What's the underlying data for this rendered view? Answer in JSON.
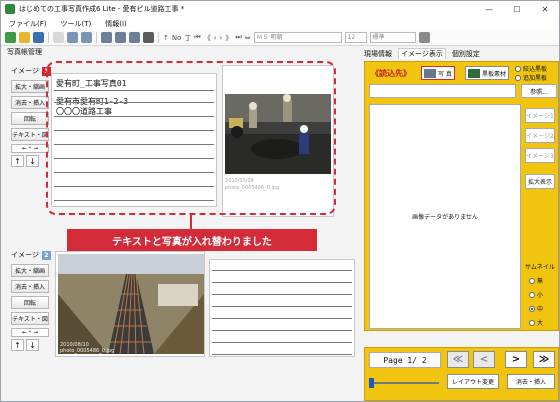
{
  "window": {
    "title": "はじめての工事写真作成6 Lite - 愛有ビル道路工事 *",
    "minimize": "—",
    "maximize": "☐",
    "close": "✕"
  },
  "menu": [
    "ファイル(F)",
    "ツール(T)",
    "情報(I)"
  ],
  "toolbar": {
    "no_label": "No",
    "font_name": "ＭＳ 明朝",
    "font_size": "12",
    "style": "標準"
  },
  "left": {
    "panel_title": "写真帳管理",
    "slot1": {
      "label": "イメージ",
      "num": "1",
      "buttons": [
        "拡大・縮画",
        "消去・挿入",
        "回転",
        "テキスト・図"
      ],
      "lr": "←・→",
      "text_lines": [
        "愛有町_工事写真01",
        "愛有市愛有町1-2-3",
        "〇〇〇道路工事"
      ],
      "caption1": "2010/03/04",
      "caption2": "photo_0005486_0.jpg"
    },
    "slot2": {
      "label": "イメージ",
      "num": "2",
      "buttons": [
        "拡大・縮画",
        "消去・挿入",
        "回転",
        "テキスト・図"
      ],
      "lr": "←・→",
      "caption1": "2010/08/10",
      "caption2": "photo_0005486_0.jpg"
    },
    "up": "↑",
    "down": "↓"
  },
  "callout": "テキストと写真が入れ替わりました",
  "right": {
    "tabs": [
      "現場情報",
      "イメージ表示",
      "個別設定"
    ],
    "read_label": "《読込先》",
    "photo_tab": "写 真",
    "board_tab": "黒板素材",
    "radios": [
      "絞込黒板",
      "追加黒板"
    ],
    "ref_button": "参照...",
    "no_image": "画像データがありません",
    "side_buttons": [
      "イメージ1",
      "イメージ2",
      "イメージ3",
      "拡大表示"
    ],
    "thumb_size": "サムネイル",
    "sizes": [
      "無",
      "小",
      "中",
      "大"
    ],
    "selected_size": "中",
    "page": "Page 1/ 2",
    "nav": [
      "≪",
      "<",
      ">",
      "≫"
    ],
    "layout_button": "レイアウト変更",
    "delete_button": "消去・挿入"
  }
}
